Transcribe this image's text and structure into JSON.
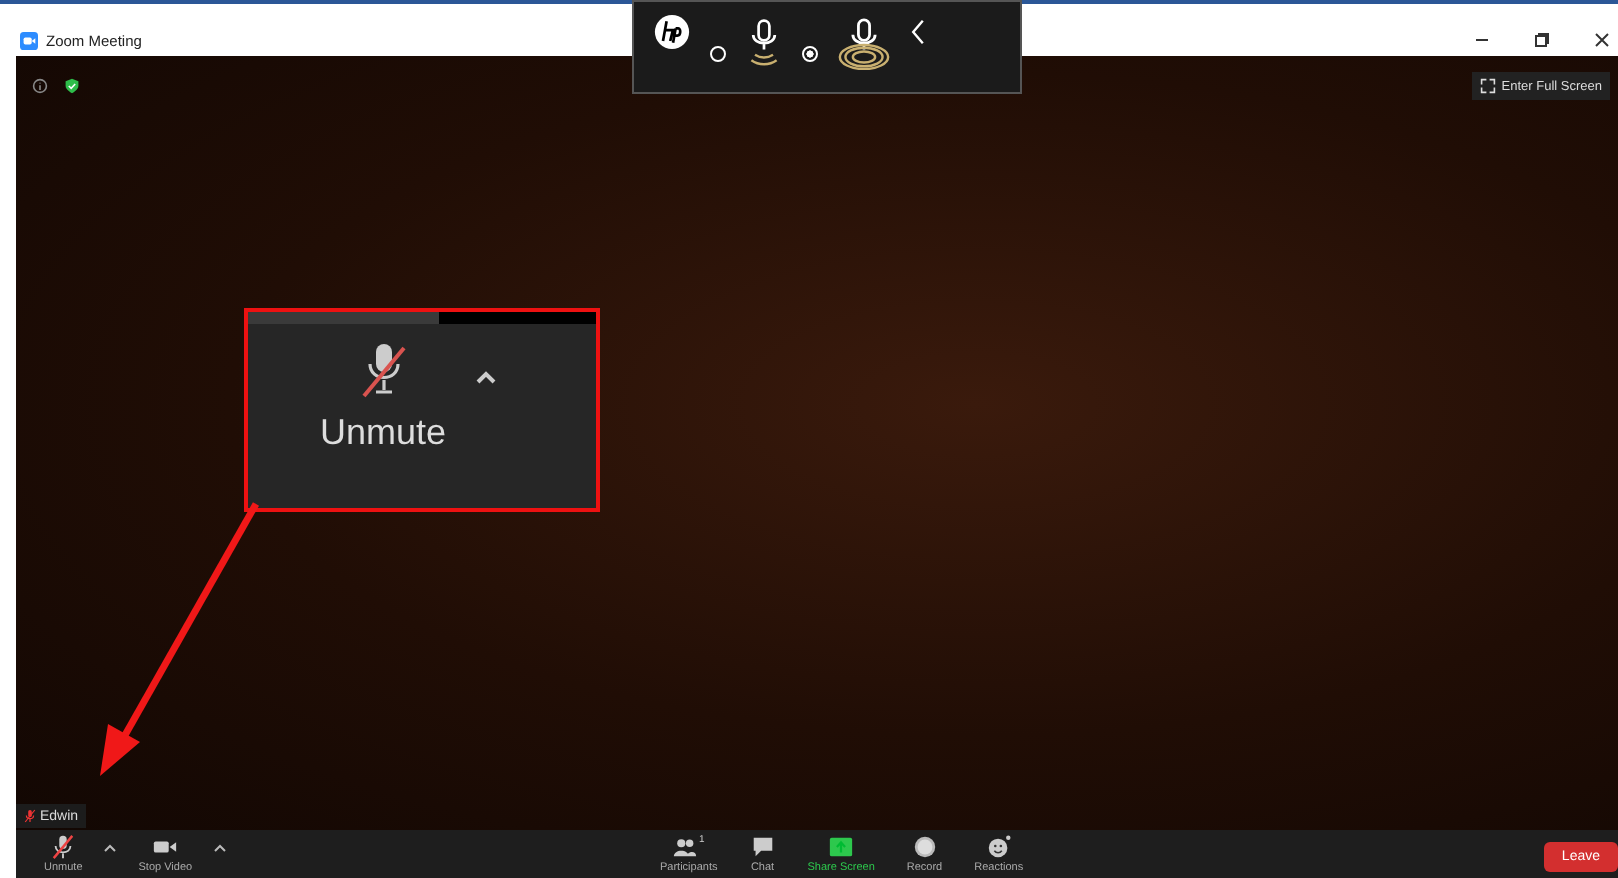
{
  "window": {
    "title": "Zoom Meeting"
  },
  "audio_overlay": {
    "options": [
      {
        "selected": false
      },
      {
        "selected": true
      }
    ]
  },
  "full_screen_button": {
    "label": "Enter Full Screen"
  },
  "name_tag": {
    "name": "Edwin",
    "muted": true
  },
  "callout": {
    "label": "Unmute",
    "muted": true
  },
  "toolbar": {
    "items": [
      {
        "kind": "mic",
        "label": "Unmute",
        "muted": true,
        "caret": true
      },
      {
        "kind": "video",
        "label": "Stop Video",
        "caret": true
      },
      {
        "kind": "participants",
        "label": "Participants",
        "count": "1"
      },
      {
        "kind": "chat",
        "label": "Chat"
      },
      {
        "kind": "share",
        "label": "Share Screen"
      },
      {
        "kind": "record",
        "label": "Record"
      },
      {
        "kind": "reactions",
        "label": "Reactions"
      }
    ],
    "leave": "Leave"
  }
}
